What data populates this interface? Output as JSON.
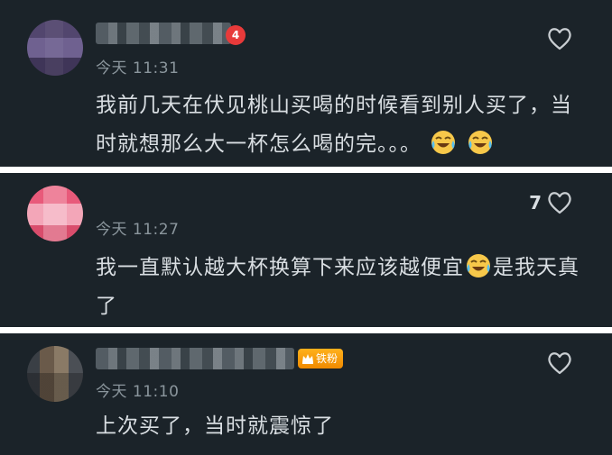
{
  "comments": [
    {
      "user_badge": "4",
      "timestamp": "今天 11:31",
      "like_count": "",
      "text_parts": [
        "我前几天在伏见桃山买喝的时候看到别人买了，当时就想那么大一杯怎么喝的完。。。"
      ],
      "emoji": "laughing-crying-face"
    },
    {
      "timestamp": "今天 11:27",
      "like_count": "7",
      "text_parts": [
        "我一直默认越大杯换算下来应该越便宜",
        "是我天真了"
      ],
      "emoji": "laughing-crying-face"
    },
    {
      "badge_label": "铁粉",
      "timestamp": "今天 11:10",
      "like_count": "",
      "text_parts": [
        "上次买了，当时就震惊了"
      ]
    }
  ],
  "colors": {
    "panel_bg": "#1b2329",
    "separator": "#ffffff",
    "text": "#d9dee2",
    "timestamp": "#8b969d",
    "badge_red": "#e83a3a",
    "badge_gold": "#e8b92a",
    "fan_badge": "#f08a00"
  },
  "icons": {
    "like": "heart-outline-icon",
    "emoji": "laughing-crying-face-icon",
    "fan_badge": "crown-icon"
  }
}
